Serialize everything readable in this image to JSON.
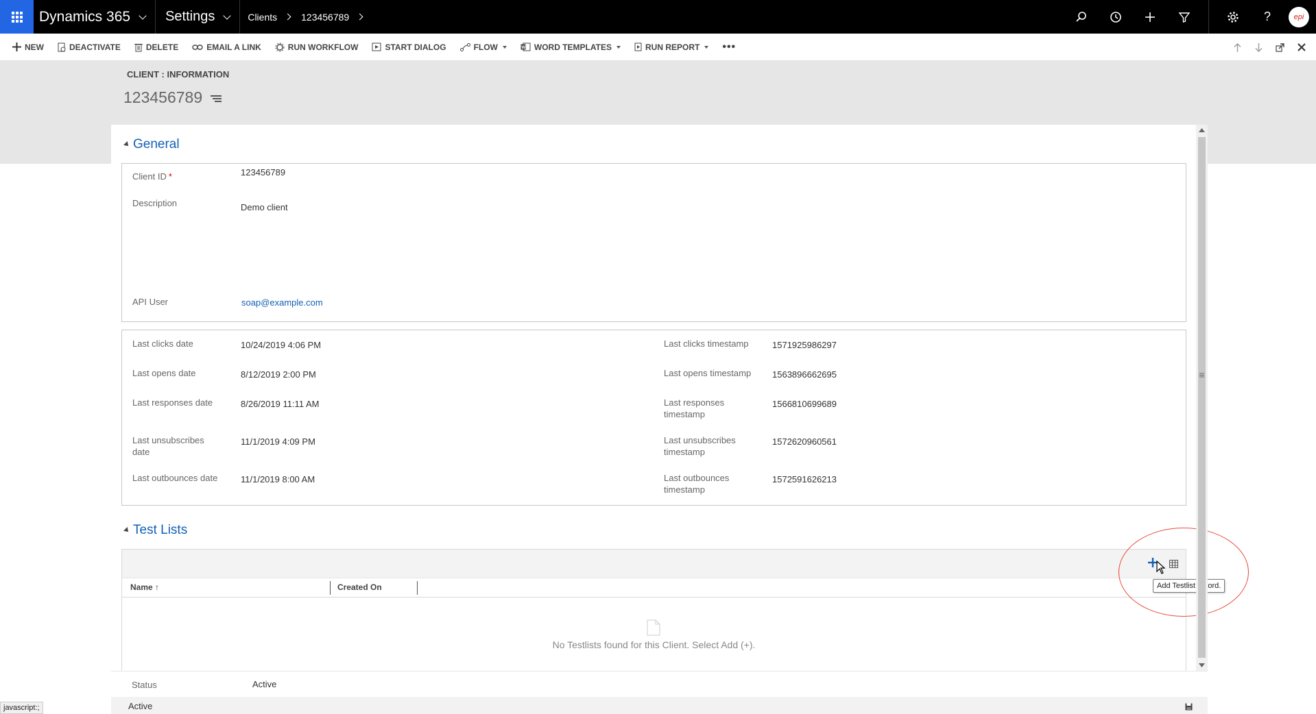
{
  "topnav": {
    "app_title": "Dynamics 365",
    "area": "Settings",
    "breadcrumb": [
      "Clients",
      "123456789"
    ],
    "avatar_text": "epi"
  },
  "commands": [
    {
      "label": "NEW",
      "icon": "plus-icon"
    },
    {
      "label": "DEACTIVATE",
      "icon": "deactivate-icon"
    },
    {
      "label": "DELETE",
      "icon": "trash-icon"
    },
    {
      "label": "EMAIL A LINK",
      "icon": "link-icon"
    },
    {
      "label": "RUN WORKFLOW",
      "icon": "workflow-icon"
    },
    {
      "label": "START DIALOG",
      "icon": "dialog-icon"
    },
    {
      "label": "FLOW",
      "icon": "flow-icon",
      "dropdown": true
    },
    {
      "label": "WORD TEMPLATES",
      "icon": "word-icon",
      "dropdown": true
    },
    {
      "label": "RUN REPORT",
      "icon": "report-icon",
      "dropdown": true
    }
  ],
  "header": {
    "entity_label": "CLIENT : INFORMATION",
    "record_title": "123456789"
  },
  "general": {
    "title": "General",
    "client_id_label": "Client ID",
    "client_id_value": "123456789",
    "description_label": "Description",
    "description_value": "Demo client",
    "api_user_label": "API User",
    "api_user_value": "soap@example.com"
  },
  "stats": {
    "left": [
      {
        "label": "Last clicks date",
        "value": "10/24/2019  4:06 PM"
      },
      {
        "label": "Last opens date",
        "value": "8/12/2019  2:00 PM"
      },
      {
        "label": "Last responses date",
        "value": "8/26/2019  11:11 AM"
      },
      {
        "label": "Last unsubscribes date",
        "value": "11/1/2019  4:09 PM"
      },
      {
        "label": "Last outbounces date",
        "value": "11/1/2019  8:00 AM"
      }
    ],
    "right": [
      {
        "label": "Last clicks timestamp",
        "value": "1571925986297"
      },
      {
        "label": "Last opens timestamp",
        "value": "1563896662695"
      },
      {
        "label": "Last responses timestamp",
        "value": "1566810699689"
      },
      {
        "label": "Last unsubscribes timestamp",
        "value": "1572620960561"
      },
      {
        "label": "Last outbounces timestamp",
        "value": "1572591626213"
      }
    ]
  },
  "testlists": {
    "title": "Test Lists",
    "columns": [
      "Name",
      "Created On"
    ],
    "empty_message": "No Testlists found for this Client. Select Add (+).",
    "tooltip": "Add Testlist record."
  },
  "status": {
    "label": "Status",
    "value": "Active",
    "footer_state": "Active"
  },
  "browser_status": "javascript:;",
  "colors": {
    "brand_blue": "#2266e3",
    "link_blue": "#1160b7",
    "annotation_red": "#e74c3c"
  }
}
